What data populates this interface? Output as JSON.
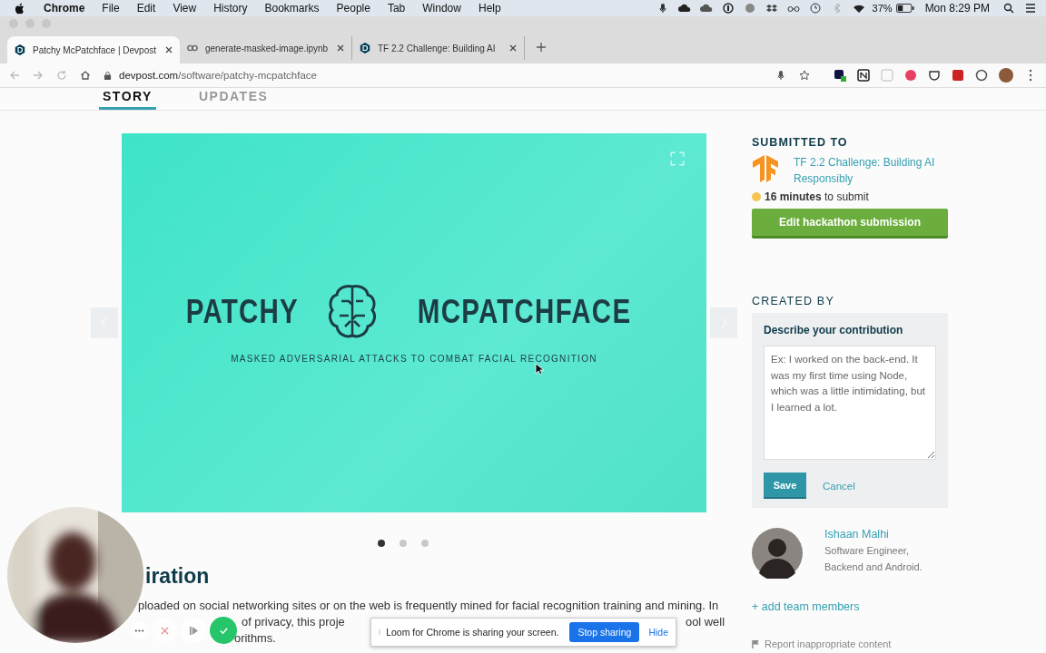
{
  "menubar": {
    "app": "Chrome",
    "items": [
      "File",
      "Edit",
      "View",
      "History",
      "Bookmarks",
      "People",
      "Tab",
      "Window",
      "Help"
    ],
    "battery": "37%",
    "clock": "Mon 8:29 PM"
  },
  "browser_tabs": [
    {
      "title": "Patchy McPatchface | Devpost",
      "selected": true
    },
    {
      "title": "generate-masked-image.ipynb",
      "selected": false
    },
    {
      "title": "TF 2.2 Challenge: Building AI",
      "selected": false
    }
  ],
  "address": {
    "host": "devpost.com",
    "path": "/software/patchy-mcpatchface"
  },
  "page_tabs": [
    {
      "label": "STORY",
      "selected": true
    },
    {
      "label": "UPDATES",
      "selected": false
    }
  ],
  "slide": {
    "title_left": "PATCHY",
    "title_right": "MCPATCHFACE",
    "subtitle": "MASKED ADVERSARIAL ATTACKS TO COMBAT FACIAL RECOGNITION"
  },
  "carousel_dots": [
    {
      "selected": true
    },
    {
      "selected": false
    },
    {
      "selected": false
    }
  ],
  "story": {
    "heading": "iration",
    "line_1": "ploaded on social networking sites or on the web is frequently mined for facial recognition training and mining. In",
    "line_2a": "of privacy, this proje",
    "line_2b": "ool well",
    "line_3b": "orithms."
  },
  "sidebar": {
    "submitted_heading": "SUBMITTED TO",
    "challenge": "TF 2.2 Challenge: Building AI Responsibly",
    "deadline": "**16 minutes** to submit",
    "edit_button": "Edit hackathon submission",
    "created_heading": "CREATED BY",
    "contribution_label": "Describe your contribution",
    "contribution_placeholder": "Ex: I worked on the back-end. It was my first time using Node, which was a little intimidating, but I learned a lot.",
    "save": "Save",
    "cancel": "Cancel",
    "member_name": "Ishaan Malhi",
    "member_role": "Software Engineer, Backend and Android.",
    "add_members": "+ add team members",
    "report": "Report inappropriate content"
  },
  "loom": {
    "message": "Loom for Chrome is sharing your screen.",
    "stop": "Stop sharing",
    "hide": "Hide"
  }
}
